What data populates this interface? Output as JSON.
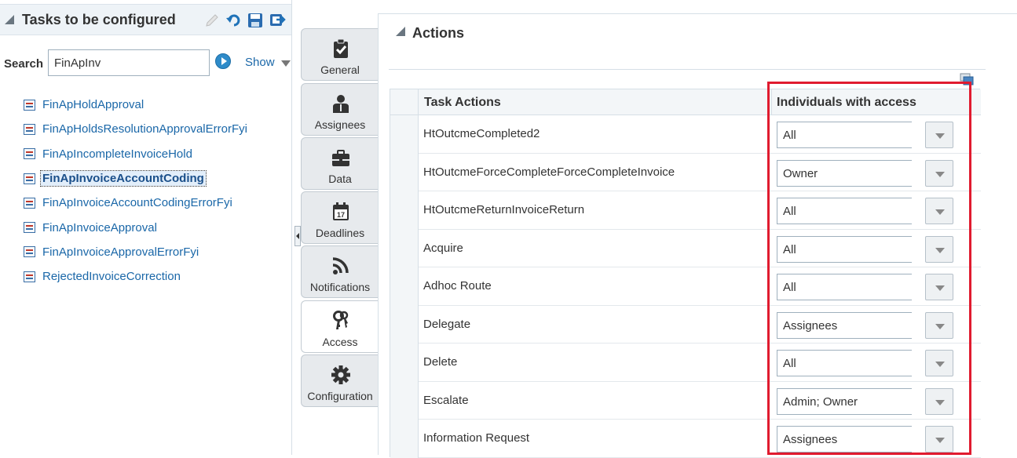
{
  "left_panel": {
    "title": "Tasks to be configured",
    "toolbar_icons": [
      "edit-pencil-icon",
      "refresh-icon",
      "save-icon",
      "commit-icon"
    ],
    "search": {
      "label": "Search",
      "value": "FinApInv",
      "go_icon": "go-arrow-icon",
      "show_label": "Show"
    },
    "tasks": [
      {
        "label": "FinApHoldApproval",
        "selected": false
      },
      {
        "label": "FinApHoldsResolutionApprovalErrorFyi",
        "selected": false
      },
      {
        "label": "FinApIncompleteInvoiceHold",
        "selected": false
      },
      {
        "label": "FinApInvoiceAccountCoding",
        "selected": true
      },
      {
        "label": "FinApInvoiceAccountCodingErrorFyi",
        "selected": false
      },
      {
        "label": "FinApInvoiceApproval",
        "selected": false
      },
      {
        "label": "FinApInvoiceApprovalErrorFyi",
        "selected": false
      },
      {
        "label": "RejectedInvoiceCorrection",
        "selected": false
      }
    ]
  },
  "tabs": [
    {
      "label": "General",
      "icon": "checklist-icon",
      "active": false
    },
    {
      "label": "Assignees",
      "icon": "person-icon",
      "active": false
    },
    {
      "label": "Data",
      "icon": "briefcase-icon",
      "active": false
    },
    {
      "label": "Deadlines",
      "icon": "calendar-icon",
      "active": false
    },
    {
      "label": "Notifications",
      "icon": "rss-icon",
      "active": false
    },
    {
      "label": "Access",
      "icon": "keys-icon",
      "active": true
    },
    {
      "label": "Configuration",
      "icon": "gear-icon",
      "active": false
    }
  ],
  "calendar_day": "17",
  "content": {
    "section_title": "Actions",
    "columns": {
      "task_actions": "Task Actions",
      "individuals": "Individuals with access"
    },
    "rows": [
      {
        "action": "HtOutcmeCompleted2",
        "access": "All"
      },
      {
        "action": "HtOutcmeForceCompleteForceCompleteInvoice",
        "access": "Owner"
      },
      {
        "action": "HtOutcmeReturnInvoiceReturn",
        "access": "All"
      },
      {
        "action": "Acquire",
        "access": "All"
      },
      {
        "action": "Adhoc Route",
        "access": "All"
      },
      {
        "action": "Delegate",
        "access": "Assignees"
      },
      {
        "action": "Delete",
        "access": "All"
      },
      {
        "action": "Escalate",
        "access": "Admin; Owner"
      },
      {
        "action": "Information Request",
        "access": "Assignees"
      }
    ]
  },
  "colors": {
    "link": "#1a67a8",
    "highlight": "#e01b2f",
    "header_bg": "#eef3f7"
  }
}
